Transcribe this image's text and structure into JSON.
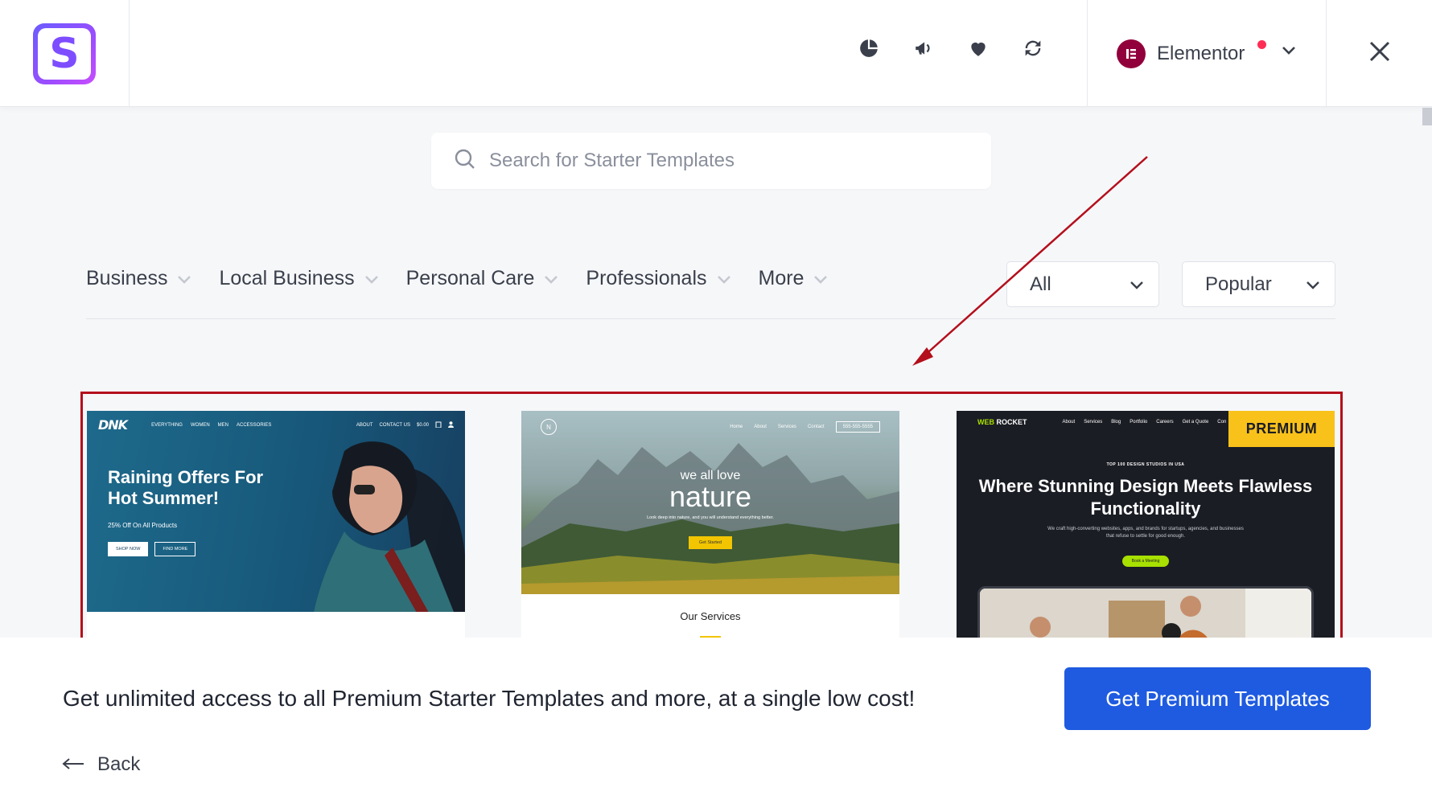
{
  "header": {
    "builder": {
      "name": "Elementor"
    },
    "icons": [
      "pie-chart-icon",
      "megaphone-icon",
      "heart-icon",
      "sync-icon"
    ]
  },
  "search": {
    "placeholder": "Search for Starter Templates"
  },
  "filters": {
    "categories": [
      "Business",
      "Local Business",
      "Personal Care",
      "Professionals",
      "More"
    ],
    "type_select": "All",
    "sort_select": "Popular"
  },
  "templates": [
    {
      "nav_logo": "DNK",
      "nav_links": [
        "EVERYTHING",
        "WOMEN",
        "MEN",
        "ACCESSORIES"
      ],
      "nav_right": [
        "ABOUT",
        "CONTACT US",
        "$0.00"
      ],
      "title": "Raining Offers For Hot Summer!",
      "subtitle": "25% Off On All Products",
      "btn_primary": "SHOP NOW",
      "btn_secondary": "FIND MORE"
    },
    {
      "nav_links": [
        "Home",
        "About",
        "Services",
        "Contact"
      ],
      "nav_cta": "555-555-5555",
      "pre_title": "we all love",
      "title": "nature",
      "blurb": "Look deep into nature, and you will understand everything better.",
      "button": "Get Started",
      "section_title": "Our Services"
    },
    {
      "badge": "PREMIUM",
      "nav_logo_prefix": "WEB",
      "nav_logo_suffix": "ROCKET",
      "nav_links": [
        "About",
        "Services",
        "Blog",
        "Portfolio",
        "Careers",
        "Get a Quote",
        "Con"
      ],
      "kicker": "TOP 100 DESIGN STUDIOS IN USA",
      "title": "Where Stunning Design Meets Flawless Functionality",
      "desc": "We craft high-converting websites, apps, and brands for startups, agencies, and businesses that refuse to settle for good enough.",
      "button": "Book a Meeting"
    }
  ],
  "promo": {
    "text": "Get unlimited access to all Premium Starter Templates and more, at a single low cost!",
    "button": "Get Premium Templates"
  },
  "back_label": "Back",
  "colors": {
    "accent": "#1f5be0",
    "annotation": "#b40f1c",
    "premium_badge": "#f9c21b",
    "elementor": "#92003b"
  }
}
